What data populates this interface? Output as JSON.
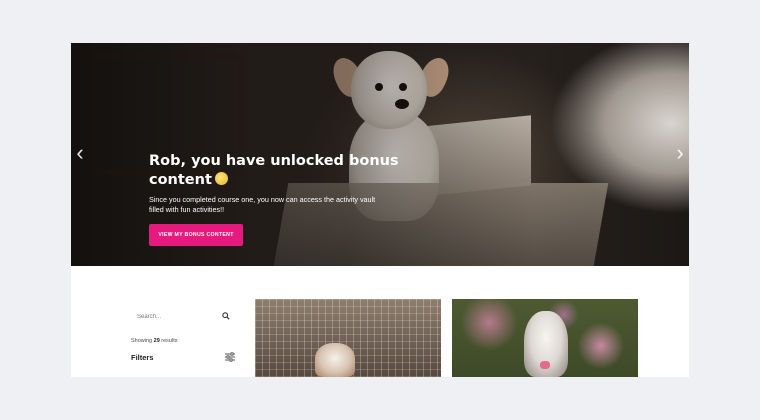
{
  "hero": {
    "title": "Rob, you have unlocked bonus content",
    "subtitle": "Since you completed course one, you now can access the activity vault filled with fun activities!!",
    "cta_label": "VIEW MY BONUS CONTENT",
    "prev_arrow": "‹",
    "next_arrow": "›"
  },
  "sidebar": {
    "search_placeholder": "Search...",
    "results_prefix": "Showing ",
    "results_count": "29",
    "results_suffix": " results",
    "filters_label": "Filters"
  },
  "colors": {
    "cta": "#e5197e",
    "background": "#eef0f4"
  },
  "icons": {
    "search": "search-icon",
    "filter": "sliders-icon",
    "emoji": "grinning-emoji-icon"
  }
}
